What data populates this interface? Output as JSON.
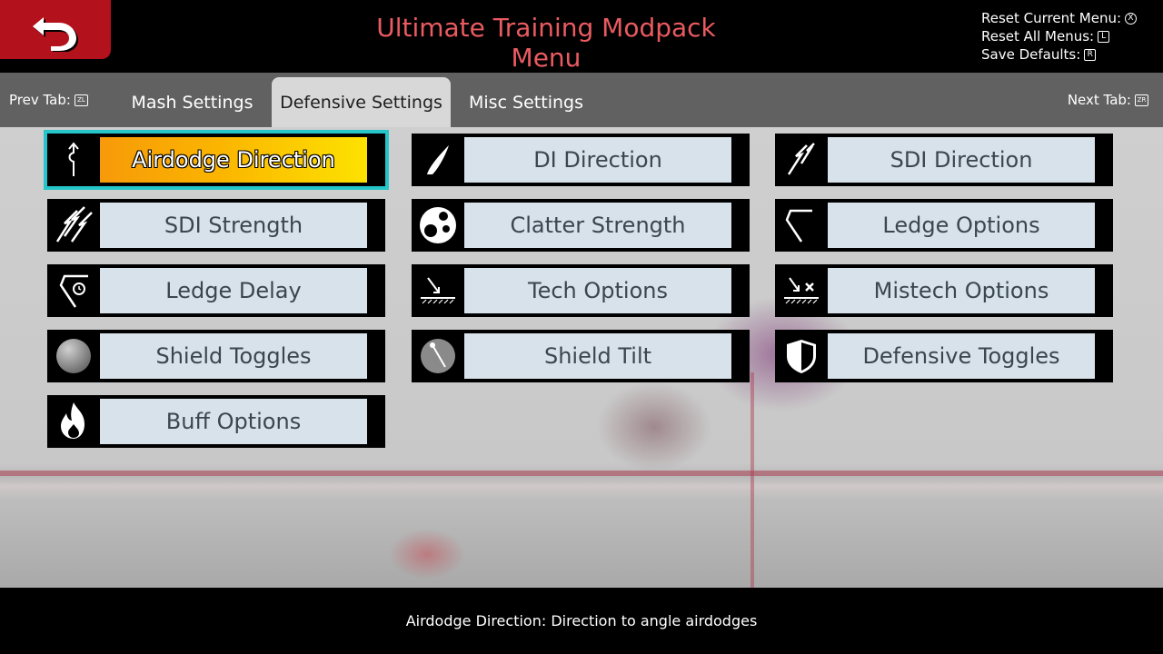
{
  "header": {
    "title": "Ultimate Training Modpack Menu",
    "hints": [
      {
        "text": "Reset Current Menu:",
        "button": "X"
      },
      {
        "text": "Reset All Menus:",
        "button": "L"
      },
      {
        "text": "Save Defaults:",
        "button": "R"
      }
    ],
    "back_icon": "return-arrow-icon"
  },
  "tabbar": {
    "prev_label": "Prev Tab:",
    "prev_button": "ZL",
    "next_label": "Next Tab:",
    "next_button": "ZR",
    "tabs": [
      {
        "label": "Mash Settings",
        "active": false
      },
      {
        "label": "Defensive Settings",
        "active": true
      },
      {
        "label": "Misc Settings",
        "active": false
      }
    ]
  },
  "menu": {
    "items": [
      {
        "label": "Airdodge Direction",
        "icon": "airdodge-icon",
        "selected": true
      },
      {
        "label": "DI Direction",
        "icon": "di-icon",
        "selected": false
      },
      {
        "label": "SDI Direction",
        "icon": "sdi-direction-icon",
        "selected": false
      },
      {
        "label": "SDI Strength",
        "icon": "sdi-strength-icon",
        "selected": false
      },
      {
        "label": "Clatter Strength",
        "icon": "clatter-icon",
        "selected": false
      },
      {
        "label": "Ledge Options",
        "icon": "ledge-icon",
        "selected": false
      },
      {
        "label": "Ledge Delay",
        "icon": "ledge-delay-icon",
        "selected": false
      },
      {
        "label": "Tech Options",
        "icon": "tech-icon",
        "selected": false
      },
      {
        "label": "Mistech Options",
        "icon": "mistech-icon",
        "selected": false
      },
      {
        "label": "Shield Toggles",
        "icon": "shield-ball-icon",
        "selected": false
      },
      {
        "label": "Shield Tilt",
        "icon": "shield-tilt-icon",
        "selected": false
      },
      {
        "label": "Defensive Toggles",
        "icon": "defensive-shield-icon",
        "selected": false
      },
      {
        "label": "Buff Options",
        "icon": "flame-icon",
        "selected": false
      }
    ]
  },
  "footer": {
    "help_text": "Airdodge Direction: Direction to angle airdodges"
  },
  "colors": {
    "accent_title": "#ea5b61",
    "back_button": "#b3111c",
    "selection_outline": "#25c6c9",
    "item_label_bg": "#d7e2ea",
    "selected_gradient_start": "#f79a09",
    "selected_gradient_end": "#fde200"
  }
}
